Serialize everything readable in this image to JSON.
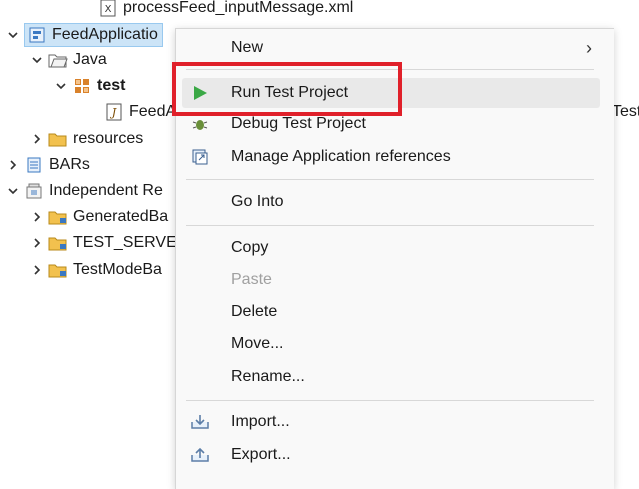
{
  "tree": {
    "top_file": "processFeed_inputMessage.xml",
    "project": "FeedApplicatio",
    "java": "Java",
    "test": "test",
    "feed_file": "FeedA",
    "truncated_right": "Test.j",
    "resources": "resources",
    "bars": "BARs",
    "independent": "Independent Re",
    "generated": "GeneratedBa",
    "test_server": "TEST_SERVEF",
    "testmode": "TestModeBa"
  },
  "menu": {
    "new": "New",
    "run_test_project": "Run Test Project",
    "debug_test_project": "Debug Test Project",
    "manage_app_refs": "Manage Application references",
    "go_into": "Go Into",
    "copy": "Copy",
    "paste": "Paste",
    "delete": "Delete",
    "move": "Move...",
    "rename": "Rename...",
    "import": "Import...",
    "export": "Export...",
    "submenu_arrow": "›"
  },
  "colors": {
    "highlight_box": "#e0202a",
    "selection": "#cce4f7",
    "run_icon": "#3aa845"
  }
}
